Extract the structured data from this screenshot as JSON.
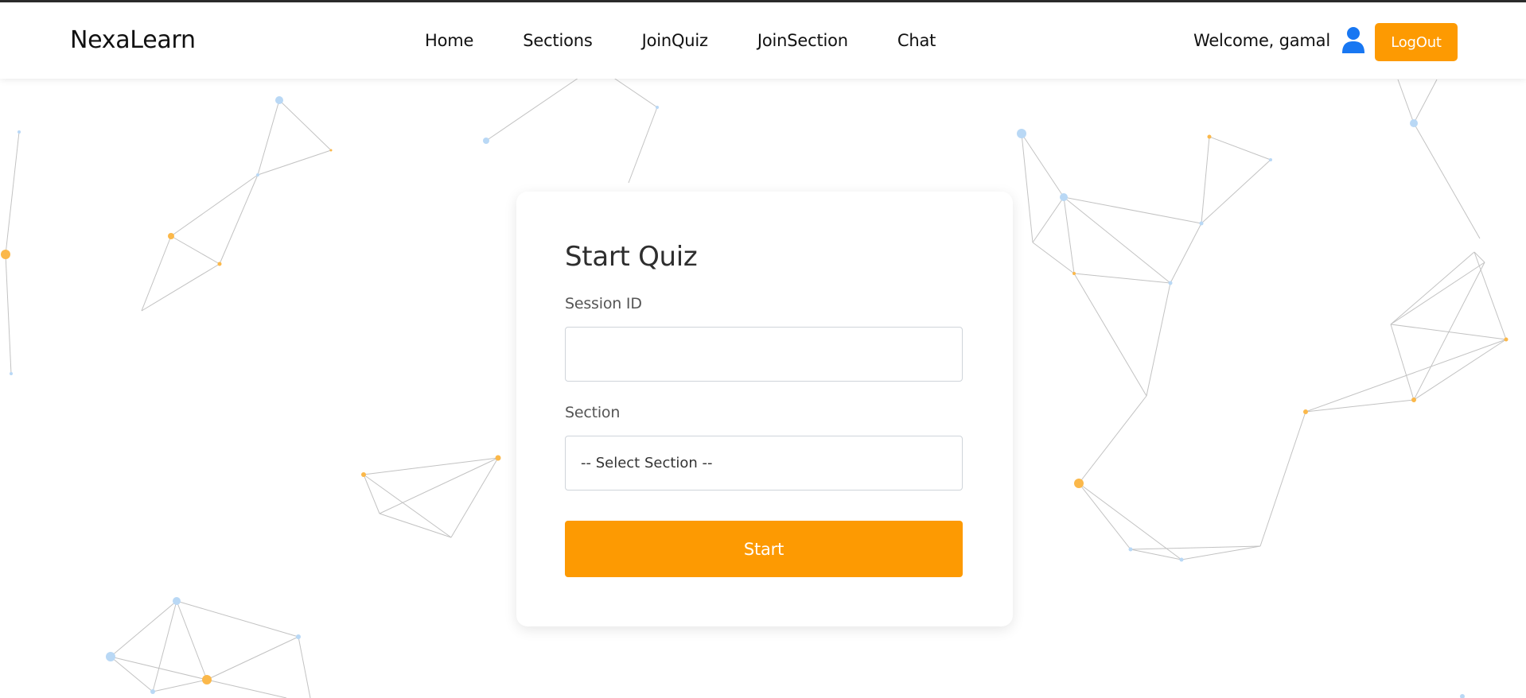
{
  "header": {
    "brand": "NexaLearn",
    "nav": [
      "Home",
      "Sections",
      "JoinQuiz",
      "JoinSection",
      "Chat"
    ],
    "welcome": "Welcome, gamal",
    "user_icon": "user-icon",
    "logout_label": "LogOut"
  },
  "form": {
    "title": "Start Quiz",
    "session_label": "Session ID",
    "session_value": "",
    "section_label": "Section",
    "section_selected": "-- Select Section --",
    "start_label": "Start"
  },
  "colors": {
    "accent": "#fd9a02",
    "user_icon": "#1877f2",
    "node_blue": "#b9d8f5",
    "node_orange": "#fbb84a",
    "line_gray": "#9a9a9a"
  }
}
